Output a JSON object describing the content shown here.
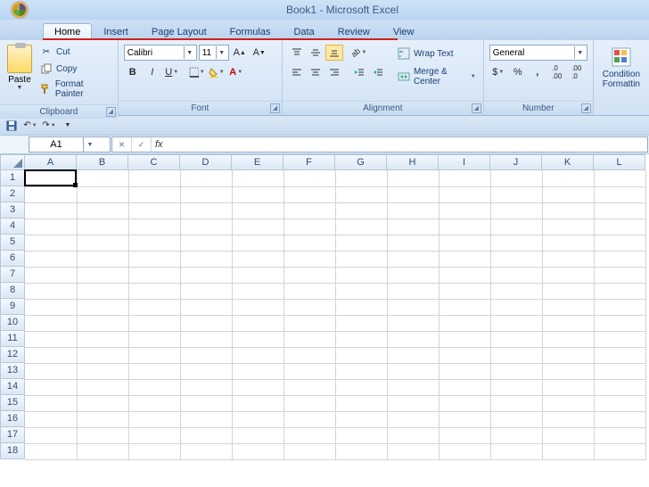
{
  "app": {
    "title": "Book1 - Microsoft Excel"
  },
  "tabs": [
    "Home",
    "Insert",
    "Page Layout",
    "Formulas",
    "Data",
    "Review",
    "View"
  ],
  "active_tab": "Home",
  "ribbon": {
    "clipboard": {
      "paste": "Paste",
      "cut": "Cut",
      "copy": "Copy",
      "format_painter": "Format Painter",
      "label": "Clipboard"
    },
    "font": {
      "name": "Calibri",
      "size": "11",
      "label": "Font"
    },
    "alignment": {
      "wrap": "Wrap Text",
      "merge": "Merge & Center",
      "label": "Alignment"
    },
    "number": {
      "format": "General",
      "label": "Number"
    },
    "styles": {
      "conditional_l1": "Condition",
      "conditional_l2": "Formattin"
    }
  },
  "qat": {
    "save_icon": "💾"
  },
  "namebox": {
    "value": "A1"
  },
  "formula": {
    "value": ""
  },
  "columns": [
    "A",
    "B",
    "C",
    "D",
    "E",
    "F",
    "G",
    "H",
    "I",
    "J",
    "K",
    "L"
  ],
  "rows": [
    1,
    2,
    3,
    4,
    5,
    6,
    7,
    8,
    9,
    10,
    11,
    12,
    13,
    14,
    15,
    16,
    17,
    18
  ],
  "active_cell": "A1"
}
